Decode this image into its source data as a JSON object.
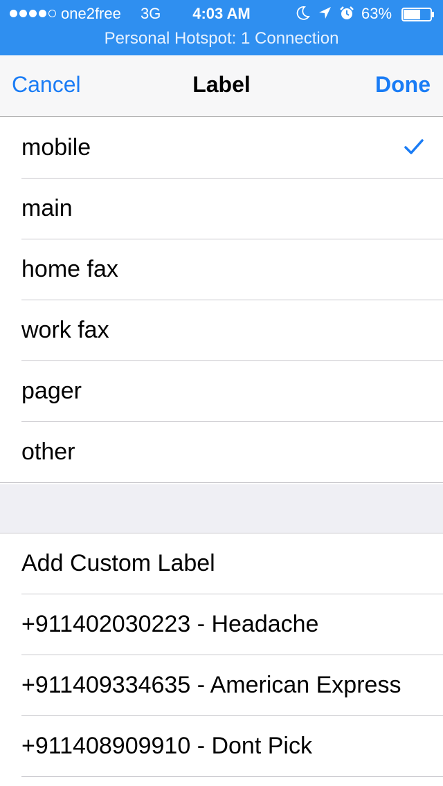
{
  "status_bar": {
    "carrier": "one2free",
    "network": "3G",
    "time": "4:03 AM",
    "battery_percent": "63%",
    "battery_level": 0.63,
    "signal_bars_filled": 4,
    "signal_bars_total": 5,
    "icons": [
      "moon-icon",
      "location-arrow-icon",
      "alarm-icon"
    ],
    "hotspot_text": "Personal Hotspot: 1 Connection",
    "background_color": "#2f8ff0"
  },
  "nav": {
    "cancel_label": "Cancel",
    "title": "Label",
    "done_label": "Done",
    "accent_color": "#1a7cf5"
  },
  "label_options": [
    {
      "label": "mobile",
      "selected": true
    },
    {
      "label": "main",
      "selected": false
    },
    {
      "label": "home fax",
      "selected": false
    },
    {
      "label": "work fax",
      "selected": false
    },
    {
      "label": "pager",
      "selected": false
    },
    {
      "label": "other",
      "selected": false
    }
  ],
  "custom_section": {
    "add_custom_label": "Add Custom Label",
    "custom_labels": [
      "+911402030223 - Headache",
      "+911409334635 - American Express",
      "+911408909910 - Dont Pick"
    ]
  }
}
